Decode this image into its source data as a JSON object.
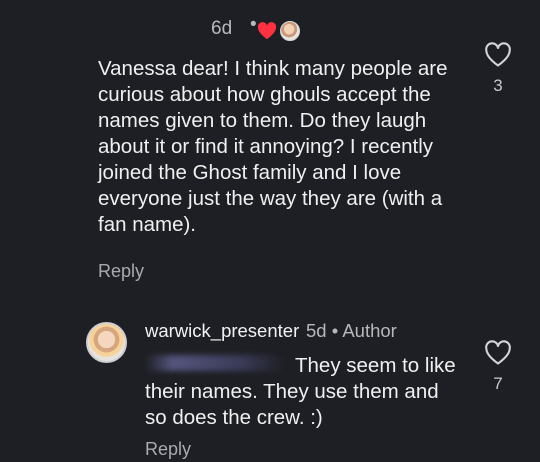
{
  "comment": {
    "timestamp": "6d",
    "separator": "•",
    "text": "Vanessa dear! I think many people are\ncurious about how ghouls accept the\nnames given to them. Do they laugh\nabout it or find it annoying? I recently\njoined the Ghost family and I love\neveryone just the way they are (with a\nfan name).",
    "like_icon": "heart-outline-icon",
    "like_count": "3",
    "reply_label": "Reply",
    "author_liked_icon": "heart-filled-icon",
    "accent_color": "#ff3040"
  },
  "reply": {
    "username": "warwick_presenter",
    "meta": "5d • Author",
    "text": "They seem to like\ntheir names.  They use them and\nso does the crew. :)",
    "like_icon": "heart-outline-icon",
    "like_count": "7",
    "reply_label": "Reply"
  }
}
